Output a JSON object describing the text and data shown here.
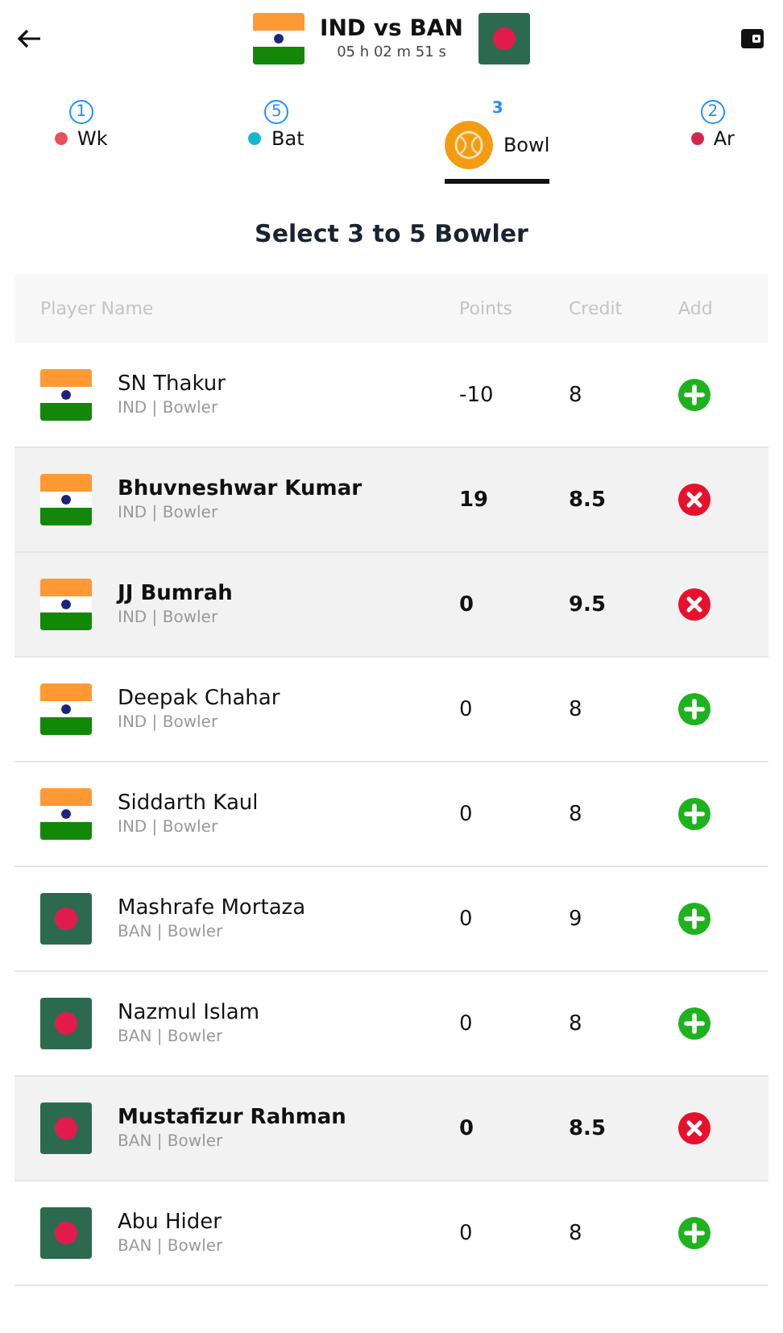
{
  "header": {
    "title": "IND vs BAN",
    "timer": "05 h 02 m 51 s",
    "team_flags": [
      {
        "kind": "india"
      },
      {
        "kind": "bangladesh"
      }
    ]
  },
  "tabs": [
    {
      "count": "1",
      "label": "Wk",
      "color": "#e8505b",
      "selected": false
    },
    {
      "count": "5",
      "label": "Bat",
      "color": "#17b6cf",
      "selected": false
    },
    {
      "count": "3",
      "label": "Bowl",
      "color": "#f39c12",
      "selected": true
    },
    {
      "count": "2",
      "label": "Ar",
      "color": "#d2254f",
      "selected": false
    }
  ],
  "instruction": "Select 3 to 5 Bowler",
  "table": {
    "columns": [
      "Player Name",
      "Points",
      "Credit",
      "Add"
    ],
    "rows": [
      {
        "name": "SN Thakur",
        "info": "IND | Bowler",
        "kind": "india",
        "points": "-10",
        "credit": "8",
        "selected": false
      },
      {
        "name": "Bhuvneshwar Kumar",
        "info": "IND | Bowler",
        "kind": "india",
        "points": "19",
        "credit": "8.5",
        "selected": true
      },
      {
        "name": "JJ Bumrah",
        "info": "IND | Bowler",
        "kind": "india",
        "points": "0",
        "credit": "9.5",
        "selected": true
      },
      {
        "name": "Deepak Chahar",
        "info": "IND | Bowler",
        "kind": "india",
        "points": "0",
        "credit": "8",
        "selected": false
      },
      {
        "name": "Siddarth Kaul",
        "info": "IND | Bowler",
        "kind": "india",
        "points": "0",
        "credit": "8",
        "selected": false
      },
      {
        "name": "Mashrafe Mortaza",
        "info": "BAN | Bowler",
        "kind": "bangladesh",
        "points": "0",
        "credit": "9",
        "selected": false
      },
      {
        "name": "Nazmul Islam",
        "info": "BAN | Bowler",
        "kind": "bangladesh",
        "points": "0",
        "credit": "8",
        "selected": false
      },
      {
        "name": "Mustafizur Rahman",
        "info": "BAN | Bowler",
        "kind": "bangladesh",
        "points": "0",
        "credit": "8.5",
        "selected": true
      },
      {
        "name": "Abu Hider",
        "info": "BAN | Bowler",
        "kind": "bangladesh",
        "points": "0",
        "credit": "8",
        "selected": false
      }
    ]
  }
}
